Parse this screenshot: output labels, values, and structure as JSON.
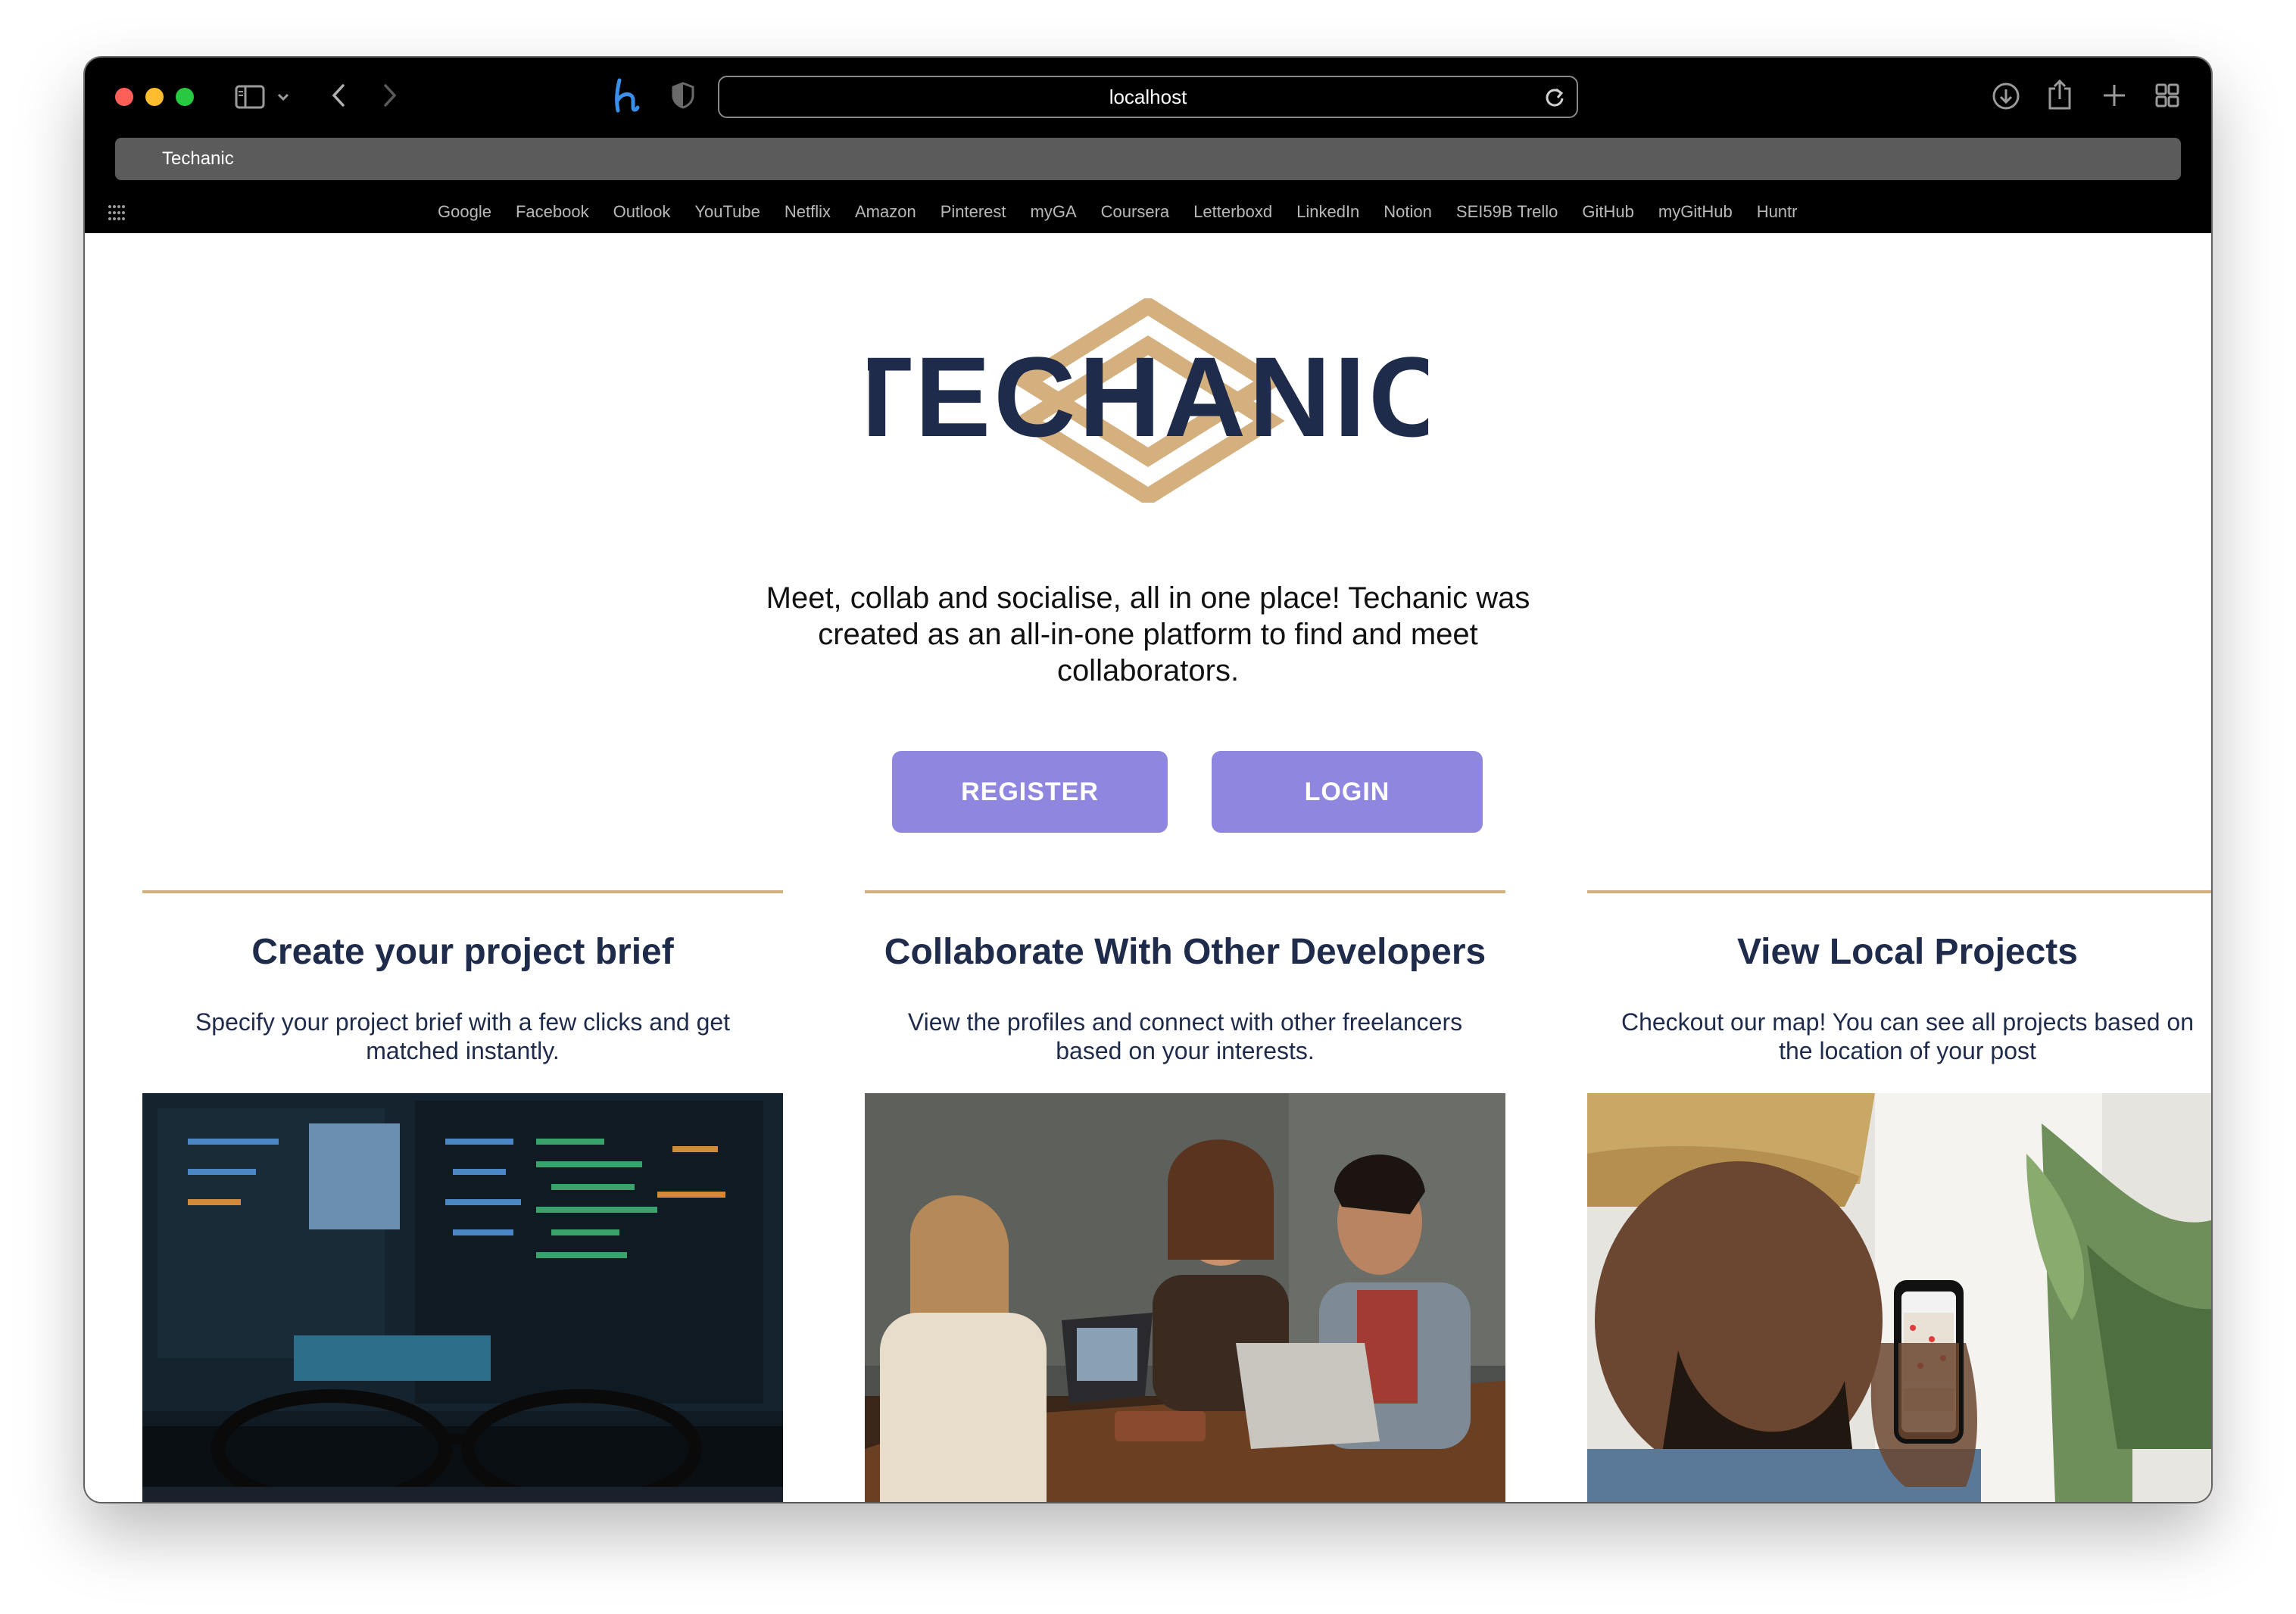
{
  "browser": {
    "url": "localhost",
    "tab_title": "Techanic",
    "bookmarks": [
      "Google",
      "Facebook",
      "Outlook",
      "YouTube",
      "Netflix",
      "Amazon",
      "Pinterest",
      "myGA",
      "Coursera",
      "Letterboxd",
      "LinkedIn",
      "Notion",
      "SEI59B Trello",
      "GitHub",
      "myGitHub",
      "Huntr"
    ]
  },
  "hero": {
    "logo_text": "TECHANIC",
    "tagline": "Meet, collab and socialise, all in one place! Techanic was created as an all-in-one platform to find and meet collaborators.",
    "register_label": "REGISTER",
    "login_label": "LOGIN"
  },
  "features": [
    {
      "title": "Create your project brief",
      "description": "Specify your project brief with a few clicks and get matched instantly."
    },
    {
      "title": "Collaborate With Other Developers",
      "description": "View the profiles and connect with other freelancers based on your interests."
    },
    {
      "title": "View Local Projects",
      "description": "Checkout our map! You can see all projects based on the location of your post"
    }
  ],
  "colors": {
    "navy": "#1f2b4a",
    "gold": "#d4b07e",
    "button": "#8f86e0"
  }
}
